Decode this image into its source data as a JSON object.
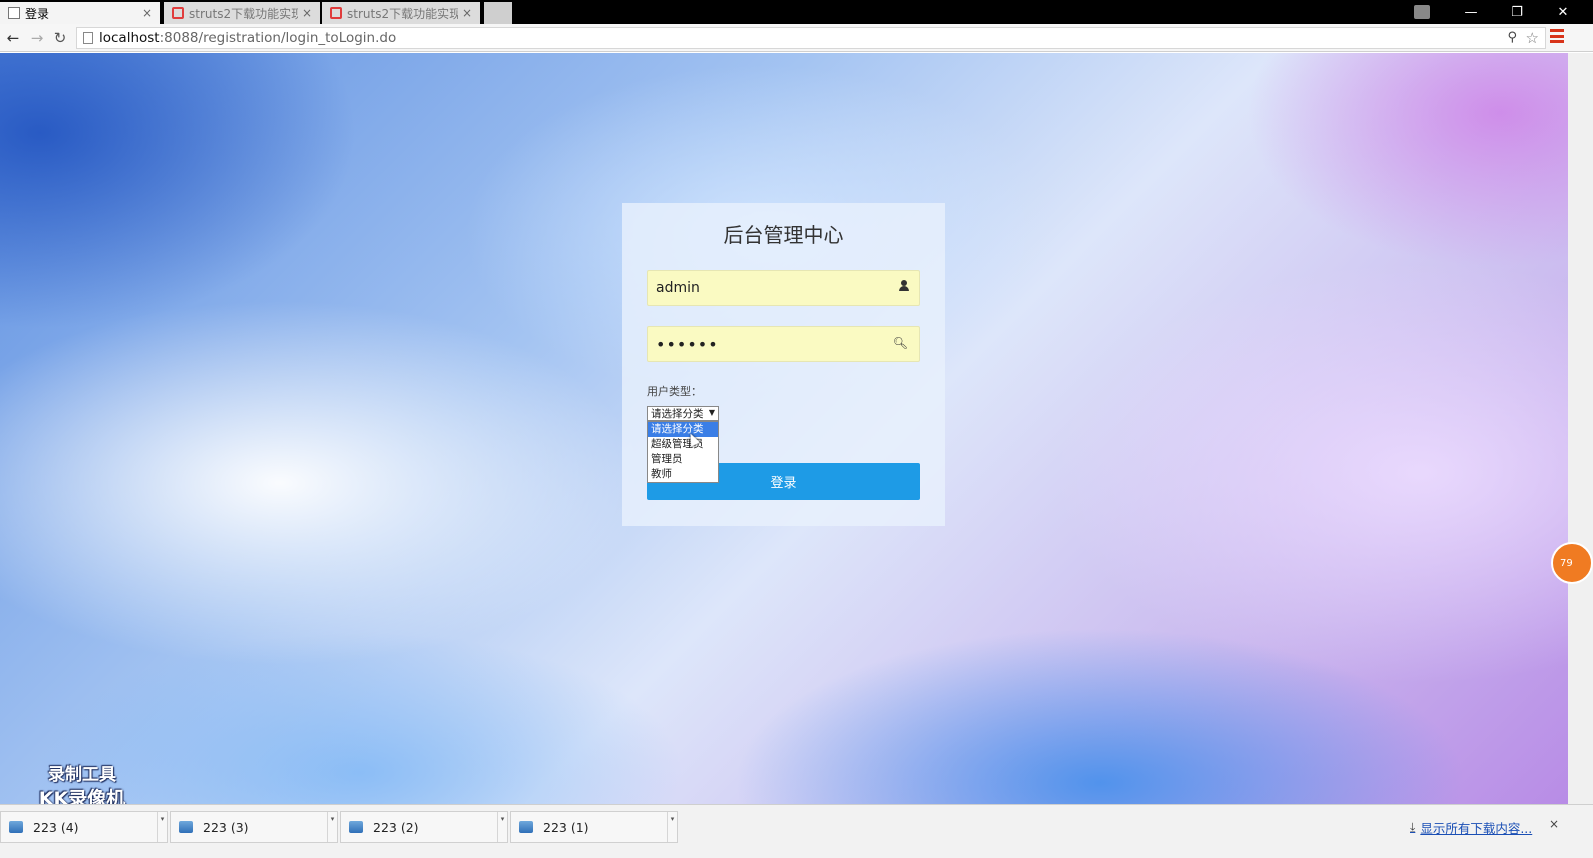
{
  "browser": {
    "tabs": [
      {
        "title": "登录",
        "active": true
      },
      {
        "title": "struts2下载功能实现",
        "active": false
      },
      {
        "title": "struts2下载功能实现",
        "active": false
      }
    ],
    "tab_close": "×",
    "window_controls": {
      "minimize": "—",
      "maximize": "❐",
      "close": "✕"
    },
    "address": {
      "host": "localhost",
      "rest": ":8088/registration/login_toLogin.do"
    },
    "nav": {
      "back": "←",
      "forward": "→",
      "reload": "↻"
    },
    "star": "☆",
    "key": "⚲"
  },
  "login": {
    "title": "后台管理中心",
    "username": "admin",
    "password": "••••••",
    "user_type_label": "用户类型：",
    "select_value": "请选择分类",
    "select_arrow": "▼",
    "options": [
      "请选择分类",
      "超级管理员",
      "管理员",
      "教师"
    ],
    "selected_option_index": 0,
    "submit_label": "登录",
    "icons": {
      "username": "user-icon",
      "password": "key-icon"
    }
  },
  "watermark": {
    "line1": "录制工具",
    "line2": "KK录像机"
  },
  "side_bubble": "79",
  "downloads": {
    "items": [
      "223 (4)",
      "223 (3)",
      "223 (2)",
      "223 (1)"
    ],
    "item_arrow": "▾",
    "show_all": "显示所有下载内容...",
    "show_all_icon": "⤓",
    "close": "×"
  },
  "colors": {
    "accent": "#1e9be6",
    "field_bg": "#fafac2",
    "selected_option": "#3a7ee6"
  }
}
